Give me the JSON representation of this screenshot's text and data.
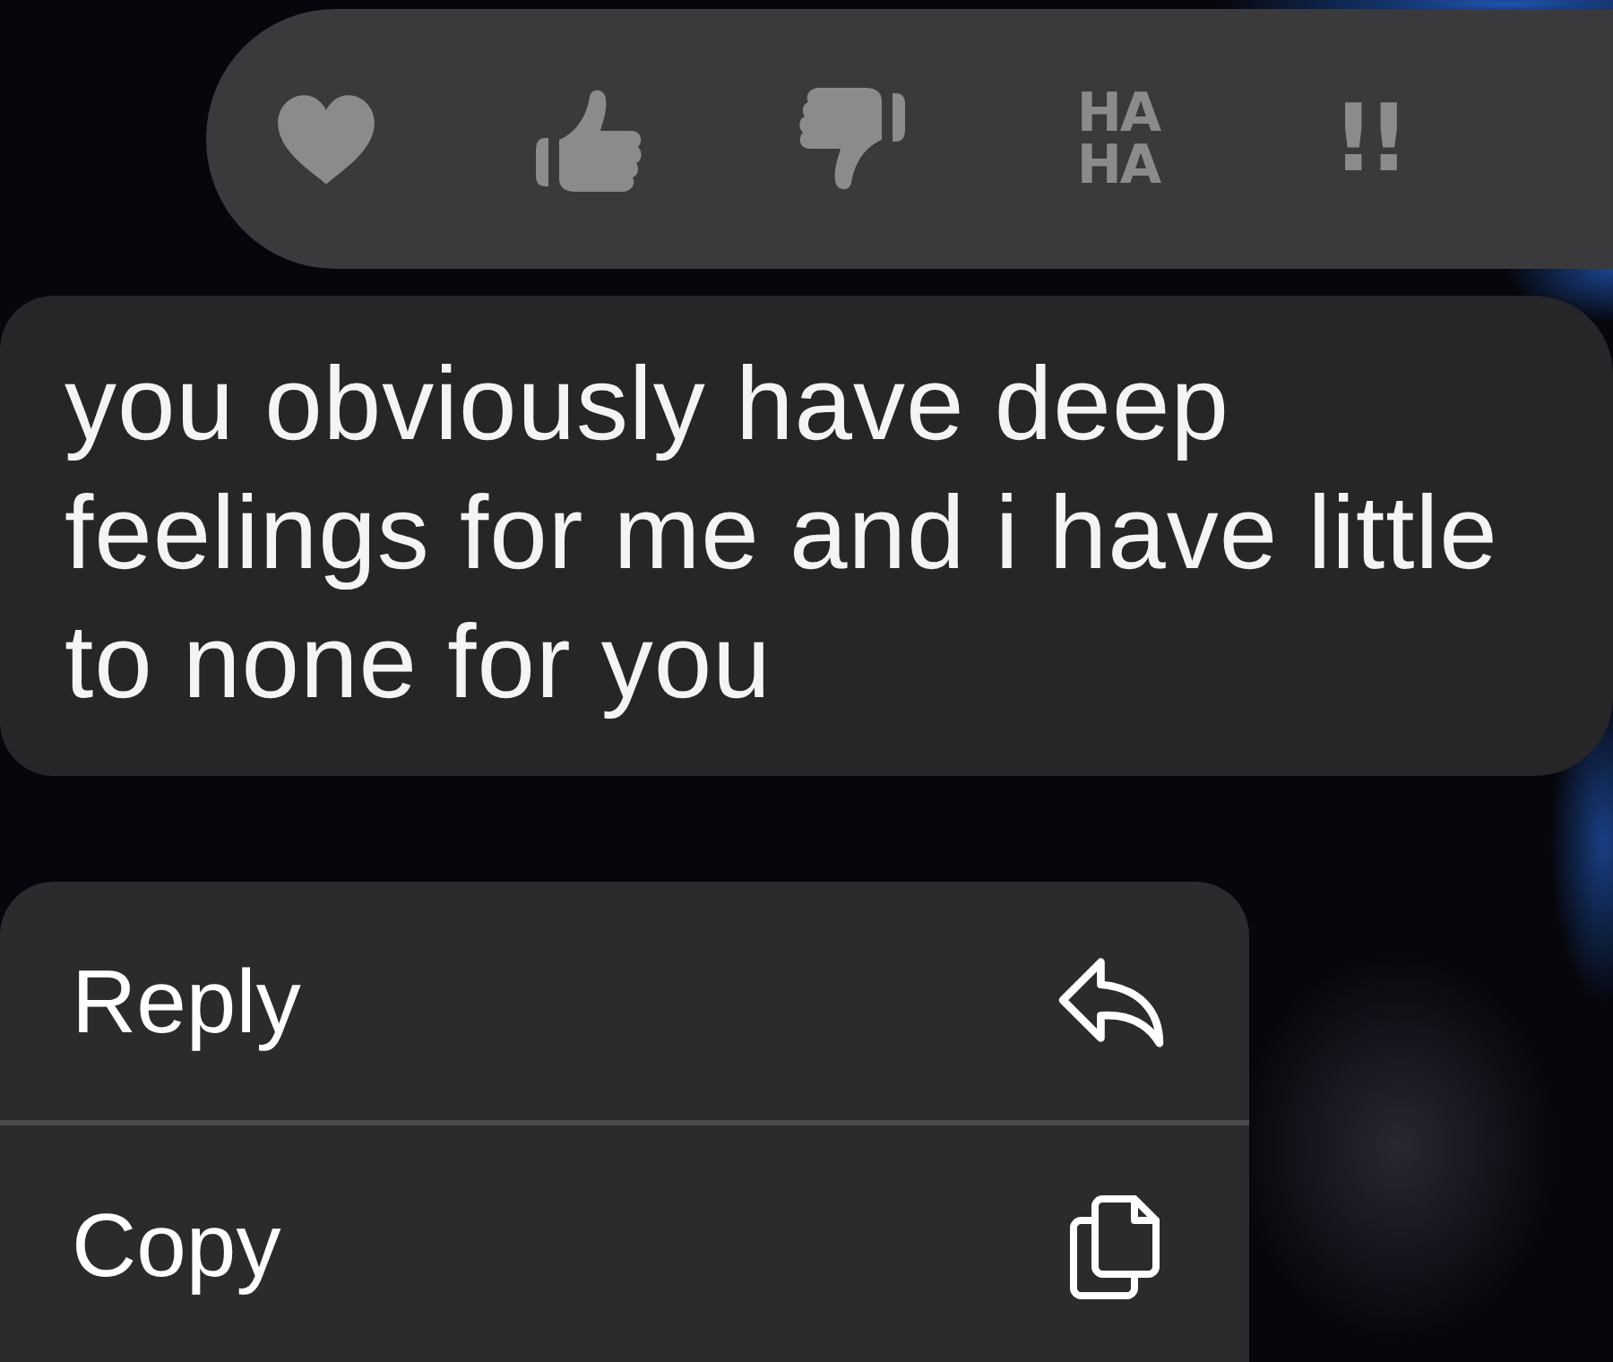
{
  "reactions": [
    {
      "kind": "heart"
    },
    {
      "kind": "thumbs_up"
    },
    {
      "kind": "thumbs_down"
    },
    {
      "kind": "text",
      "text": "HA HA"
    },
    {
      "kind": "text",
      "text": "!!"
    }
  ],
  "message": {
    "text": "you obviously have deep feelings for me and i have little to none for you"
  },
  "menu": {
    "items": [
      {
        "kind": "reply",
        "label": "Reply"
      },
      {
        "kind": "copy",
        "label": "Copy"
      }
    ]
  }
}
